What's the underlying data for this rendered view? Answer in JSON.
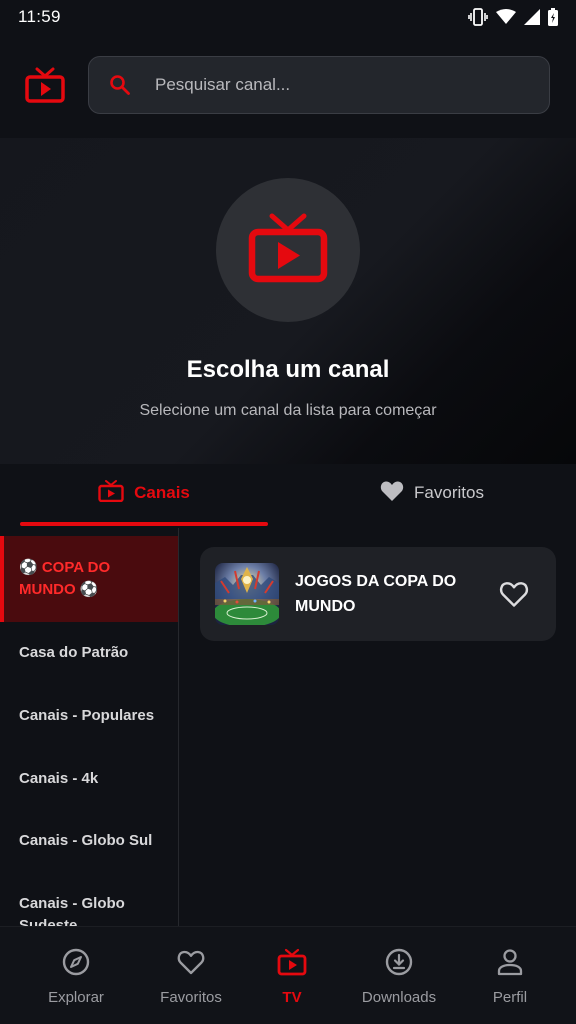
{
  "status_bar": {
    "time": "11:59"
  },
  "search": {
    "placeholder": "Pesquisar canal..."
  },
  "hero": {
    "title": "Escolha um canal",
    "subtitle": "Selecione um canal da lista para começar"
  },
  "tabs": [
    {
      "label": "Canais",
      "icon": "tv-icon",
      "active": true
    },
    {
      "label": "Favoritos",
      "icon": "heart-icon",
      "active": false
    }
  ],
  "categories": [
    {
      "label": "⚽ COPA DO MUNDO ⚽",
      "active": true
    },
    {
      "label": "Casa do Patrão",
      "active": false
    },
    {
      "label": "Canais - Populares",
      "active": false
    },
    {
      "label": "Canais - 4k",
      "active": false
    },
    {
      "label": "Canais - Globo Sul",
      "active": false
    },
    {
      "label": "Canais - Globo Sudeste",
      "active": false
    }
  ],
  "channel": {
    "title": "JOGOS DA COPA DO MUNDO",
    "favorite": false
  },
  "bottom_nav": [
    {
      "label": "Explorar",
      "icon": "compass-icon",
      "active": false
    },
    {
      "label": "Favoritos",
      "icon": "heart-icon",
      "active": false
    },
    {
      "label": "TV",
      "icon": "tv-icon",
      "active": true
    },
    {
      "label": "Downloads",
      "icon": "download-icon",
      "active": false
    },
    {
      "label": "Perfil",
      "icon": "person-icon",
      "active": false
    }
  ],
  "colors": {
    "accent": "#e5090f",
    "background": "#0f1116",
    "card": "#1f2126"
  }
}
